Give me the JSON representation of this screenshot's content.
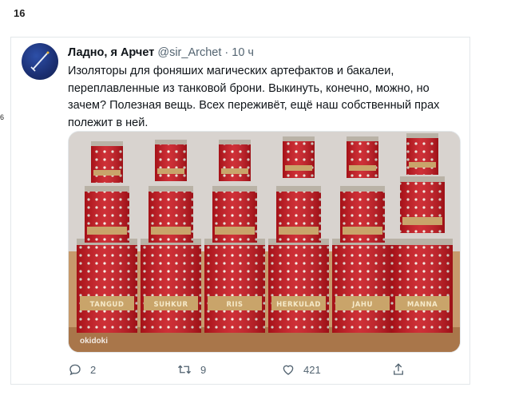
{
  "page_number": "16",
  "side_number": "6",
  "tweet": {
    "display_name": "Ладно, я Арчет",
    "handle": "@sir_Archet",
    "separator": "·",
    "time": "10 ч",
    "text": "Изоляторы для фоняших магических артефактов и бакалеи, переплавленные из танковой брони. Выкинуть, конечно, можно, но зачем? Полезная вещь. Всех переживёт, ещё наш собственный прах полежит в ней.",
    "media": {
      "watermark": "okidoki",
      "canister_labels": [
        "TANGUD",
        "SUHKUR",
        "RIIS",
        "HERKULAD",
        "JAHU",
        "MANNA"
      ]
    },
    "actions": {
      "reply_count": "2",
      "retweet_count": "9",
      "like_count": "421",
      "reply_icon": "reply-icon",
      "retweet_icon": "retweet-icon",
      "like_icon": "heart-icon",
      "share_icon": "share-icon"
    }
  },
  "colors": {
    "canister_red": "#c8141c",
    "canister_band": "#c9a46a",
    "text_secondary": "#536471"
  }
}
